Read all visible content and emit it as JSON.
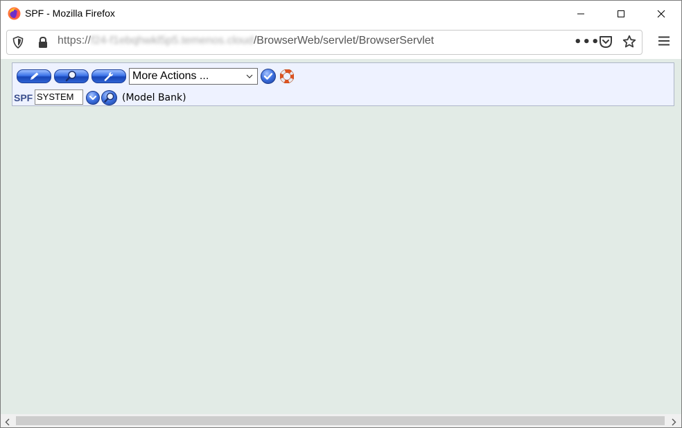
{
  "window": {
    "title": "SPF - Mozilla Firefox"
  },
  "urlbar": {
    "scheme": "https://",
    "host": "f24-f1ebqhwkl5p5.temenos.cloud",
    "path": "/BrowserWeb/servlet/BrowserServlet",
    "more_actions_glyph": "•••"
  },
  "toolbar": {
    "actions_select": "More Actions ...",
    "company_label": "SPF",
    "company_value": "SYSTEM",
    "company_name": "(Model Bank)"
  },
  "icons": [
    "firefox-logo-icon",
    "minimize-icon",
    "maximize-icon",
    "close-icon",
    "shield-icon",
    "lock-icon",
    "pocket-icon",
    "star-icon",
    "hamburger-menu-icon",
    "pencil-icon",
    "magnifier-icon",
    "wrench-icon",
    "checkmark-icon",
    "lifebuoy-icon",
    "chevron-down-icon",
    "scroll-left-icon",
    "scroll-right-icon"
  ],
  "colors": {
    "content_bg": "#e2ebe6",
    "toolbar_bg": "#eef2ff",
    "button_blue": "#2f63d3",
    "spf_label": "#3a4e8c"
  }
}
